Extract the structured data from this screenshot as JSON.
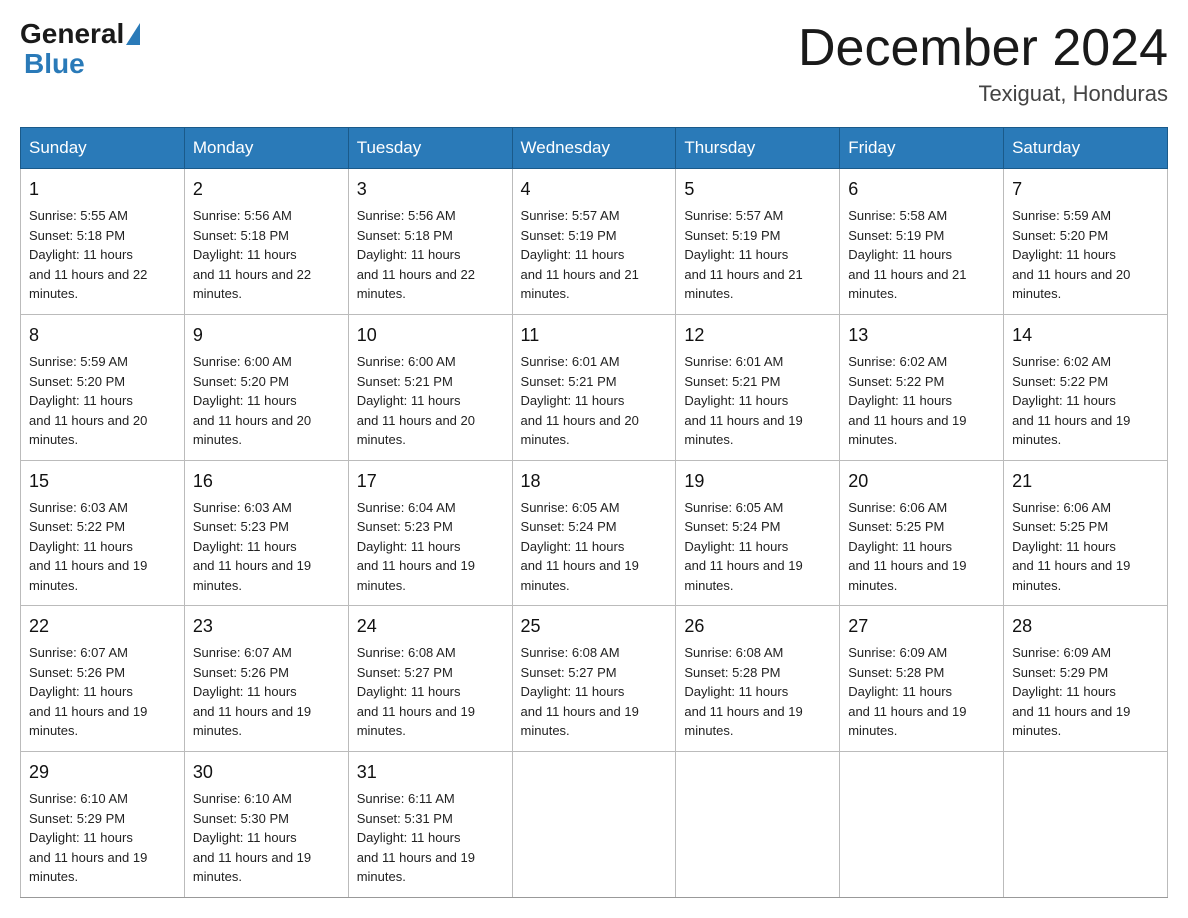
{
  "logo": {
    "general": "General",
    "blue": "Blue"
  },
  "title": {
    "month_year": "December 2024",
    "location": "Texiguat, Honduras"
  },
  "headers": [
    "Sunday",
    "Monday",
    "Tuesday",
    "Wednesday",
    "Thursday",
    "Friday",
    "Saturday"
  ],
  "weeks": [
    [
      {
        "day": "1",
        "sunrise": "5:55 AM",
        "sunset": "5:18 PM",
        "daylight": "11 hours and 22 minutes."
      },
      {
        "day": "2",
        "sunrise": "5:56 AM",
        "sunset": "5:18 PM",
        "daylight": "11 hours and 22 minutes."
      },
      {
        "day": "3",
        "sunrise": "5:56 AM",
        "sunset": "5:18 PM",
        "daylight": "11 hours and 22 minutes."
      },
      {
        "day": "4",
        "sunrise": "5:57 AM",
        "sunset": "5:19 PM",
        "daylight": "11 hours and 21 minutes."
      },
      {
        "day": "5",
        "sunrise": "5:57 AM",
        "sunset": "5:19 PM",
        "daylight": "11 hours and 21 minutes."
      },
      {
        "day": "6",
        "sunrise": "5:58 AM",
        "sunset": "5:19 PM",
        "daylight": "11 hours and 21 minutes."
      },
      {
        "day": "7",
        "sunrise": "5:59 AM",
        "sunset": "5:20 PM",
        "daylight": "11 hours and 20 minutes."
      }
    ],
    [
      {
        "day": "8",
        "sunrise": "5:59 AM",
        "sunset": "5:20 PM",
        "daylight": "11 hours and 20 minutes."
      },
      {
        "day": "9",
        "sunrise": "6:00 AM",
        "sunset": "5:20 PM",
        "daylight": "11 hours and 20 minutes."
      },
      {
        "day": "10",
        "sunrise": "6:00 AM",
        "sunset": "5:21 PM",
        "daylight": "11 hours and 20 minutes."
      },
      {
        "day": "11",
        "sunrise": "6:01 AM",
        "sunset": "5:21 PM",
        "daylight": "11 hours and 20 minutes."
      },
      {
        "day": "12",
        "sunrise": "6:01 AM",
        "sunset": "5:21 PM",
        "daylight": "11 hours and 19 minutes."
      },
      {
        "day": "13",
        "sunrise": "6:02 AM",
        "sunset": "5:22 PM",
        "daylight": "11 hours and 19 minutes."
      },
      {
        "day": "14",
        "sunrise": "6:02 AM",
        "sunset": "5:22 PM",
        "daylight": "11 hours and 19 minutes."
      }
    ],
    [
      {
        "day": "15",
        "sunrise": "6:03 AM",
        "sunset": "5:22 PM",
        "daylight": "11 hours and 19 minutes."
      },
      {
        "day": "16",
        "sunrise": "6:03 AM",
        "sunset": "5:23 PM",
        "daylight": "11 hours and 19 minutes."
      },
      {
        "day": "17",
        "sunrise": "6:04 AM",
        "sunset": "5:23 PM",
        "daylight": "11 hours and 19 minutes."
      },
      {
        "day": "18",
        "sunrise": "6:05 AM",
        "sunset": "5:24 PM",
        "daylight": "11 hours and 19 minutes."
      },
      {
        "day": "19",
        "sunrise": "6:05 AM",
        "sunset": "5:24 PM",
        "daylight": "11 hours and 19 minutes."
      },
      {
        "day": "20",
        "sunrise": "6:06 AM",
        "sunset": "5:25 PM",
        "daylight": "11 hours and 19 minutes."
      },
      {
        "day": "21",
        "sunrise": "6:06 AM",
        "sunset": "5:25 PM",
        "daylight": "11 hours and 19 minutes."
      }
    ],
    [
      {
        "day": "22",
        "sunrise": "6:07 AM",
        "sunset": "5:26 PM",
        "daylight": "11 hours and 19 minutes."
      },
      {
        "day": "23",
        "sunrise": "6:07 AM",
        "sunset": "5:26 PM",
        "daylight": "11 hours and 19 minutes."
      },
      {
        "day": "24",
        "sunrise": "6:08 AM",
        "sunset": "5:27 PM",
        "daylight": "11 hours and 19 minutes."
      },
      {
        "day": "25",
        "sunrise": "6:08 AM",
        "sunset": "5:27 PM",
        "daylight": "11 hours and 19 minutes."
      },
      {
        "day": "26",
        "sunrise": "6:08 AM",
        "sunset": "5:28 PM",
        "daylight": "11 hours and 19 minutes."
      },
      {
        "day": "27",
        "sunrise": "6:09 AM",
        "sunset": "5:28 PM",
        "daylight": "11 hours and 19 minutes."
      },
      {
        "day": "28",
        "sunrise": "6:09 AM",
        "sunset": "5:29 PM",
        "daylight": "11 hours and 19 minutes."
      }
    ],
    [
      {
        "day": "29",
        "sunrise": "6:10 AM",
        "sunset": "5:29 PM",
        "daylight": "11 hours and 19 minutes."
      },
      {
        "day": "30",
        "sunrise": "6:10 AM",
        "sunset": "5:30 PM",
        "daylight": "11 hours and 19 minutes."
      },
      {
        "day": "31",
        "sunrise": "6:11 AM",
        "sunset": "5:31 PM",
        "daylight": "11 hours and 19 minutes."
      },
      null,
      null,
      null,
      null
    ]
  ]
}
